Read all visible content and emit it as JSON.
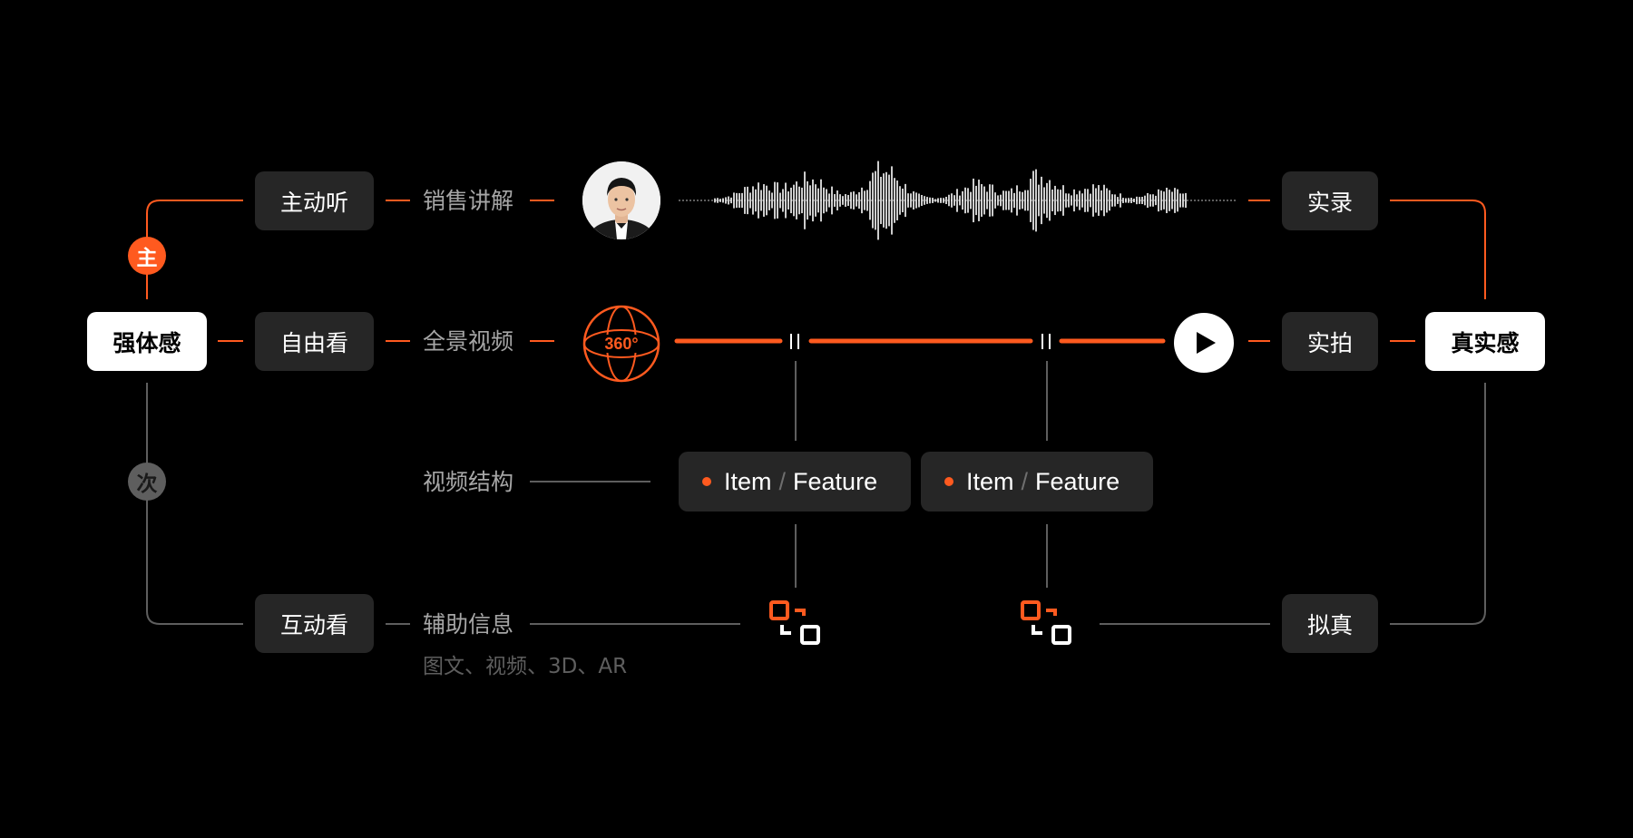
{
  "left_node": {
    "label": "强体感"
  },
  "right_node": {
    "label": "真实感"
  },
  "badges": {
    "primary": "主",
    "secondary": "次"
  },
  "rows": {
    "listen": {
      "mode": "主动听",
      "content": "销售讲解",
      "result": "实录"
    },
    "watch": {
      "mode": "自由看",
      "content": "全景视频",
      "result": "实拍",
      "panorama": "360°"
    },
    "structure": {
      "label": "视频结构"
    },
    "interact": {
      "mode": "互动看",
      "content": "辅助信息",
      "content_sub": "图文、视频、3D、AR",
      "result": "拟真"
    }
  },
  "features": [
    {
      "item": "Item",
      "sep": "/",
      "feature": "Feature"
    },
    {
      "item": "Item",
      "sep": "/",
      "feature": "Feature"
    }
  ],
  "icons": {
    "avatar": "presenter-avatar-icon",
    "waveform": "audio-waveform-icon",
    "panorama": "360-panorama-icon",
    "play": "play-icon",
    "pause": "pause-marker-icon",
    "switch": "switch-view-icon"
  },
  "colors": {
    "accent": "#ff5a1f",
    "node_dark": "#262626",
    "line_gray": "#5e5e5e",
    "label_gray": "#a6a6a6"
  }
}
